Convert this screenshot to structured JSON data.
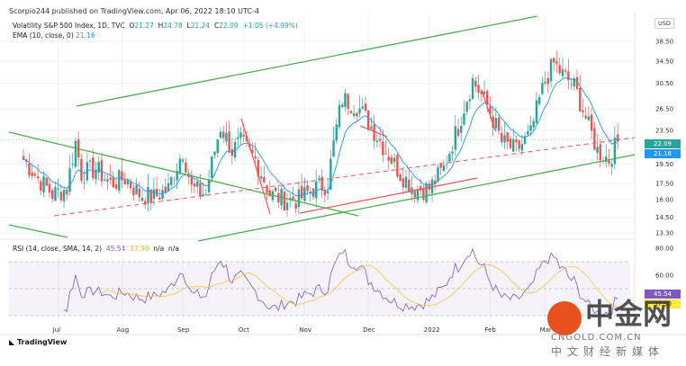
{
  "header": {
    "published": "Scorpio244 published on TradingView.com, Apr 06, 2022 18:10 UTC-4"
  },
  "legend": {
    "symbol": "Volatility S&P 500 Index, 1D, TVC",
    "o_label": "O",
    "o": "21.27",
    "h_label": "H",
    "h": "24.78",
    "l_label": "L",
    "l": "21.24",
    "c_label": "C",
    "c": "22.09",
    "change": "+1.05 (+4.99%)",
    "ema_label": "EMA (10, close, 0)",
    "ema": "21.16",
    "rsi_label": "RSI (14, close, SMA, 14, 2)",
    "rsi": "45.54",
    "rsi_sma": "37.90",
    "na1": "n/a",
    "na2": "n/a"
  },
  "currency": "USD",
  "tags": {
    "price": "22.09",
    "ema": "21.16",
    "rsi": "45.54",
    "rsi_sma": "37.90"
  },
  "colors": {
    "up": "#26a69a",
    "down": "#ef5350",
    "ema": "#2196f3",
    "rsi": "#7e57c2",
    "rsi_sma": "#f5c542",
    "trend": "#4caf50"
  },
  "footer": {
    "logo": "TradingView"
  },
  "watermark": {
    "cn": "中金网",
    "domain": "CNGOLD.COM.CN",
    "tagline": "中文财经新媒体"
  },
  "chart_data": {
    "type": "candlestick",
    "title": "Volatility S&P 500 Index, 1D, TVC",
    "y_scale": "log",
    "y_ticks": [
      38.5,
      34.5,
      30.5,
      26.5,
      23.5,
      19.5,
      17.5,
      16.0,
      14.5,
      13.3
    ],
    "y_tick_labels": [
      "38.50",
      "34.50",
      "30.50",
      "26.50",
      "23.50",
      "19.50",
      "17.50",
      "16.00",
      "14.50",
      "13.30"
    ],
    "rsi_ticks": [
      80,
      60
    ],
    "rsi_tick_labels": [
      "80.00",
      "60.00"
    ],
    "x_labels": [
      {
        "day": 12,
        "label": "Jul"
      },
      {
        "day": 34,
        "label": "Aug"
      },
      {
        "day": 55,
        "label": "Sep"
      },
      {
        "day": 76,
        "label": "Oct"
      },
      {
        "day": 97,
        "label": "Nov"
      },
      {
        "day": 119,
        "label": "Dec"
      },
      {
        "day": 140,
        "label": "2022"
      },
      {
        "day": 161,
        "label": "Feb"
      },
      {
        "day": 180,
        "label": "Mar"
      }
    ],
    "close_keypoints": [
      [
        0,
        20
      ],
      [
        5,
        18
      ],
      [
        10,
        16.5
      ],
      [
        15,
        17
      ],
      [
        18,
        22
      ],
      [
        20,
        18.5
      ],
      [
        25,
        19
      ],
      [
        30,
        17.5
      ],
      [
        35,
        18
      ],
      [
        40,
        16.5
      ],
      [
        45,
        16.2
      ],
      [
        50,
        17
      ],
      [
        55,
        21
      ],
      [
        58,
        17
      ],
      [
        63,
        16.5
      ],
      [
        68,
        24
      ],
      [
        72,
        21
      ],
      [
        75,
        22
      ],
      [
        80,
        20
      ],
      [
        85,
        16.5
      ],
      [
        90,
        16
      ],
      [
        95,
        16
      ],
      [
        100,
        17
      ],
      [
        105,
        17.5
      ],
      [
        110,
        28
      ],
      [
        115,
        27
      ],
      [
        120,
        24
      ],
      [
        125,
        21
      ],
      [
        130,
        18.5
      ],
      [
        135,
        17
      ],
      [
        140,
        17
      ],
      [
        145,
        19
      ],
      [
        150,
        24
      ],
      [
        155,
        31
      ],
      [
        160,
        27
      ],
      [
        165,
        22
      ],
      [
        170,
        21
      ],
      [
        175,
        23
      ],
      [
        180,
        31
      ],
      [
        183,
        34
      ],
      [
        186,
        32
      ],
      [
        190,
        30
      ],
      [
        195,
        24
      ],
      [
        198,
        21
      ],
      [
        202,
        20
      ],
      [
        205,
        22.09
      ]
    ]
  }
}
